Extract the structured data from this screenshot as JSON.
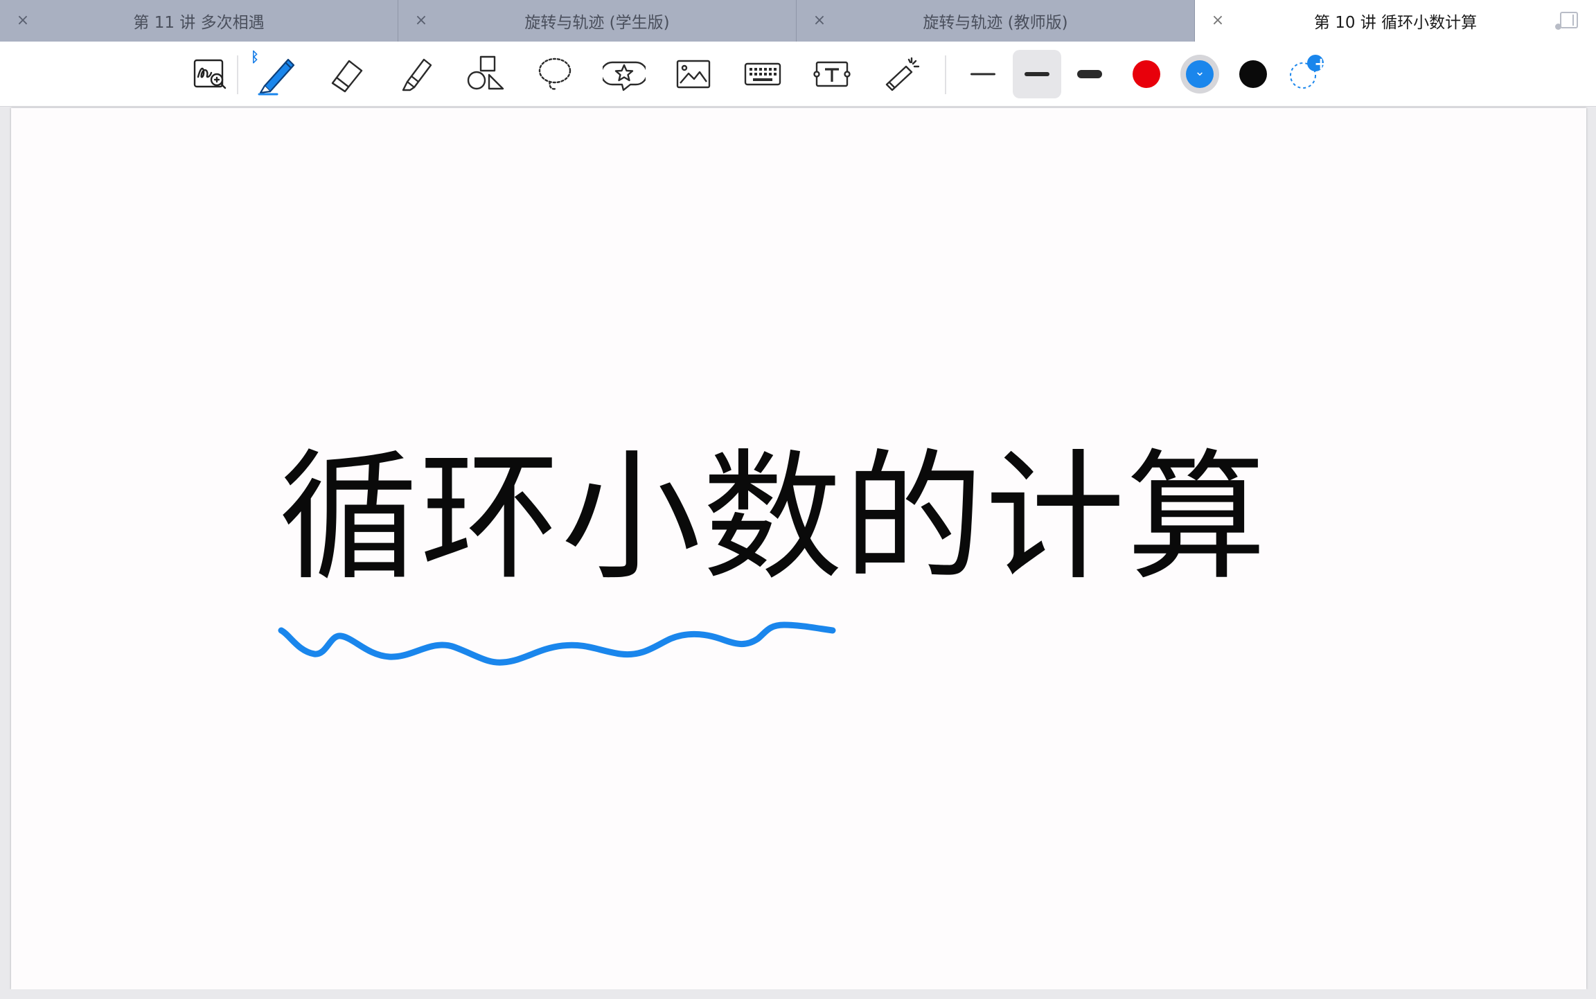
{
  "tabs": [
    {
      "close": "×",
      "label": "第 11 讲 多次相遇",
      "active": false
    },
    {
      "close": "×",
      "label": "旋转与轨迹 (学生版)",
      "active": false
    },
    {
      "close": "×",
      "label": "旋转与轨迹 (教师版)",
      "active": false
    },
    {
      "close": "×",
      "label": "第 10 讲 循环小数计算",
      "active": true
    }
  ],
  "toolbar": {
    "bluetooth_glyph": "ᛒ",
    "tools": [
      {
        "icon": "zoom-write-icon"
      },
      {
        "icon": "pen-icon",
        "selected": true
      },
      {
        "icon": "eraser-icon"
      },
      {
        "icon": "highlighter-icon"
      },
      {
        "icon": "shapes-icon"
      },
      {
        "icon": "lasso-icon"
      },
      {
        "icon": "sticker-icon"
      },
      {
        "icon": "image-icon"
      },
      {
        "icon": "keyboard-icon"
      },
      {
        "icon": "text-box-icon"
      },
      {
        "icon": "laser-pointer-icon"
      }
    ],
    "stroke_widths": [
      "thin",
      "medium",
      "thick"
    ],
    "selected_width": "medium",
    "colors": [
      {
        "name": "red",
        "hex": "#e8000b"
      },
      {
        "name": "blue",
        "hex": "#1a86ec",
        "selected": true
      },
      {
        "name": "black",
        "hex": "#0a0a0a"
      }
    ],
    "selected_color_glyph": "⌄",
    "add_color_glyph": "+"
  },
  "canvas": {
    "title": "循环小数的计算",
    "ink_color": "#1a86ec"
  }
}
